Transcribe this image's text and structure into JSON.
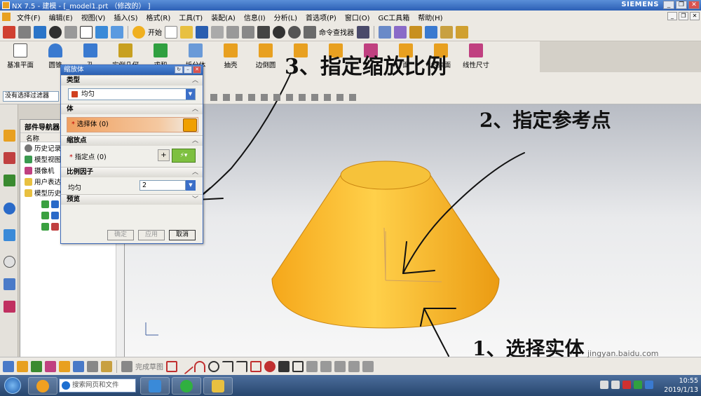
{
  "window": {
    "title": "NX 7.5 - 建模 - [_model1.prt （修改的） ]",
    "brand": "SIEMENS",
    "controls": [
      "_",
      "❐",
      "✕"
    ]
  },
  "menu": {
    "items": [
      "文件(F)",
      "编辑(E)",
      "视图(V)",
      "插入(S)",
      "格式(R)",
      "工具(T)",
      "装配(A)",
      "信息(I)",
      "分析(L)",
      "首选项(P)",
      "窗口(O)",
      "GC工具箱",
      "帮助(H)"
    ]
  },
  "toolbar_standard": {
    "start_label": "开始",
    "command_finder_label": "命令查找器"
  },
  "toolbar_features": {
    "items": [
      "基准平面",
      "圆锥",
      "孔",
      "实例几何",
      "求和",
      "拆分体",
      "抽壳",
      "边倒圆",
      "",
      "",
      "",
      "面",
      "约束面",
      "线性尺寸"
    ]
  },
  "selection_bar": {
    "filter": "没有选择过滤器"
  },
  "navigator": {
    "title": "部件导航器",
    "column_name": "名称",
    "rows": [
      "历史记录模式",
      "模型视图",
      "摄像机",
      "用户表达式",
      "模型历史记录",
      "",
      "",
      ""
    ]
  },
  "dialog": {
    "title": "缩放体",
    "section_type": "类型",
    "type_value": "均匀",
    "section_body": "体",
    "select_body_label": "选择体 (0)",
    "section_scale_point": "缩放点",
    "specify_point_label": "指定点 (0)",
    "section_scale_factor": "比例因子",
    "uniform_label": "均匀",
    "scale_value": "2",
    "section_preview": "预览",
    "ok_label": "确定",
    "apply_label": "应用",
    "cancel_label": "取消"
  },
  "annotations": {
    "step1": "1、选择实体",
    "step2": "2、指定参考点",
    "step3": "3、指定缩放比例"
  },
  "bottom_toolbar": {
    "finish_sketch": "完成草图"
  },
  "taskbar": {
    "search_placeholder": "搜索网页和文件",
    "time": "10:55",
    "date": "2019/1/13"
  },
  "watermark": {
    "site": "jingyan.baidu.com"
  },
  "colors": {
    "cone_top": "#f6c23a",
    "cone_side": "#f0a81c",
    "accent_blue": "#2a5eb0"
  }
}
